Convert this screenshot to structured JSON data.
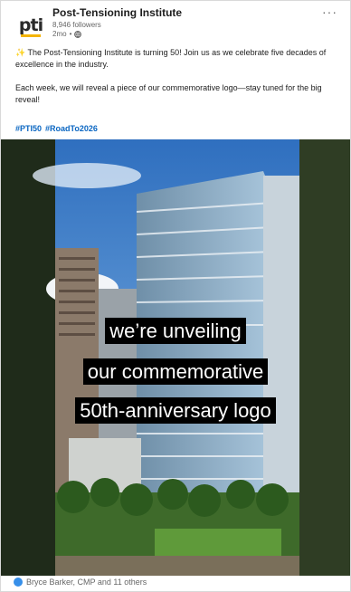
{
  "org": {
    "logo_text": "pti",
    "name": "Post-Tensioning Institute",
    "followers": "8,946 followers",
    "age": "2mo"
  },
  "header": {
    "more_label": "···"
  },
  "post": {
    "paragraph1": "✨ The Post-Tensioning Institute is turning 50! Join us as we celebrate five decades of excellence in the industry.",
    "paragraph2": "Each week, we will reveal a piece of our commemorative logo—stay tuned for the big reveal!",
    "hashtags": [
      "#PTI50",
      "#RoadTo2026"
    ]
  },
  "video": {
    "captions": [
      "we’re unveiling",
      "our commemorative",
      "50th-anniversary logo"
    ]
  },
  "footer": {
    "reactions_text": "Bryce Barker, CMP and 11 others"
  },
  "colors": {
    "hashtag": "#0a66c2",
    "logo_accent": "#f4b400",
    "like": "#378fe9"
  }
}
